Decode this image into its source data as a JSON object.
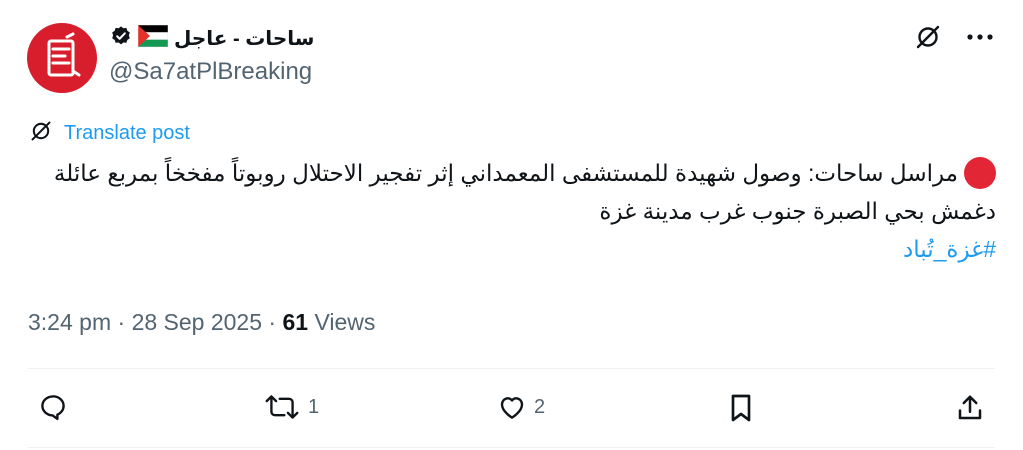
{
  "account": {
    "display_name": "ساحات - عاجل",
    "handle": "@Sa7atPlBreaking"
  },
  "translate": {
    "label": "Translate post"
  },
  "tweet": {
    "text_part1": "مراسل ساحات: وصول شهيدة للمستشفى المعمداني إثر تفجير الاحتلال روبوتاً مفخخاً بمربع عائلة",
    "text_part2": "دغمش بحي الصبرة جنوب غرب مدينة غزة",
    "hashtag": "#غزة_تُباد"
  },
  "meta": {
    "time": "3:24 pm",
    "date": "28 Sep 2025",
    "views_count": "61",
    "views_label": "Views"
  },
  "actions": {
    "retweet_count": "1",
    "like_count": "2"
  },
  "icons": {
    "avatar": "channel-logo",
    "flag": "palestine-flag",
    "verified": "verified-badge-icon",
    "grok": "grok-icon",
    "more": "more-icon",
    "reply": "reply-icon",
    "retweet": "retweet-icon",
    "like": "like-icon",
    "bookmark": "bookmark-icon",
    "share": "share-icon"
  },
  "colors": {
    "accent": "#1d9bf0",
    "avatar_bg": "#d81e2c",
    "muted": "#536471",
    "text": "#0f1419"
  }
}
